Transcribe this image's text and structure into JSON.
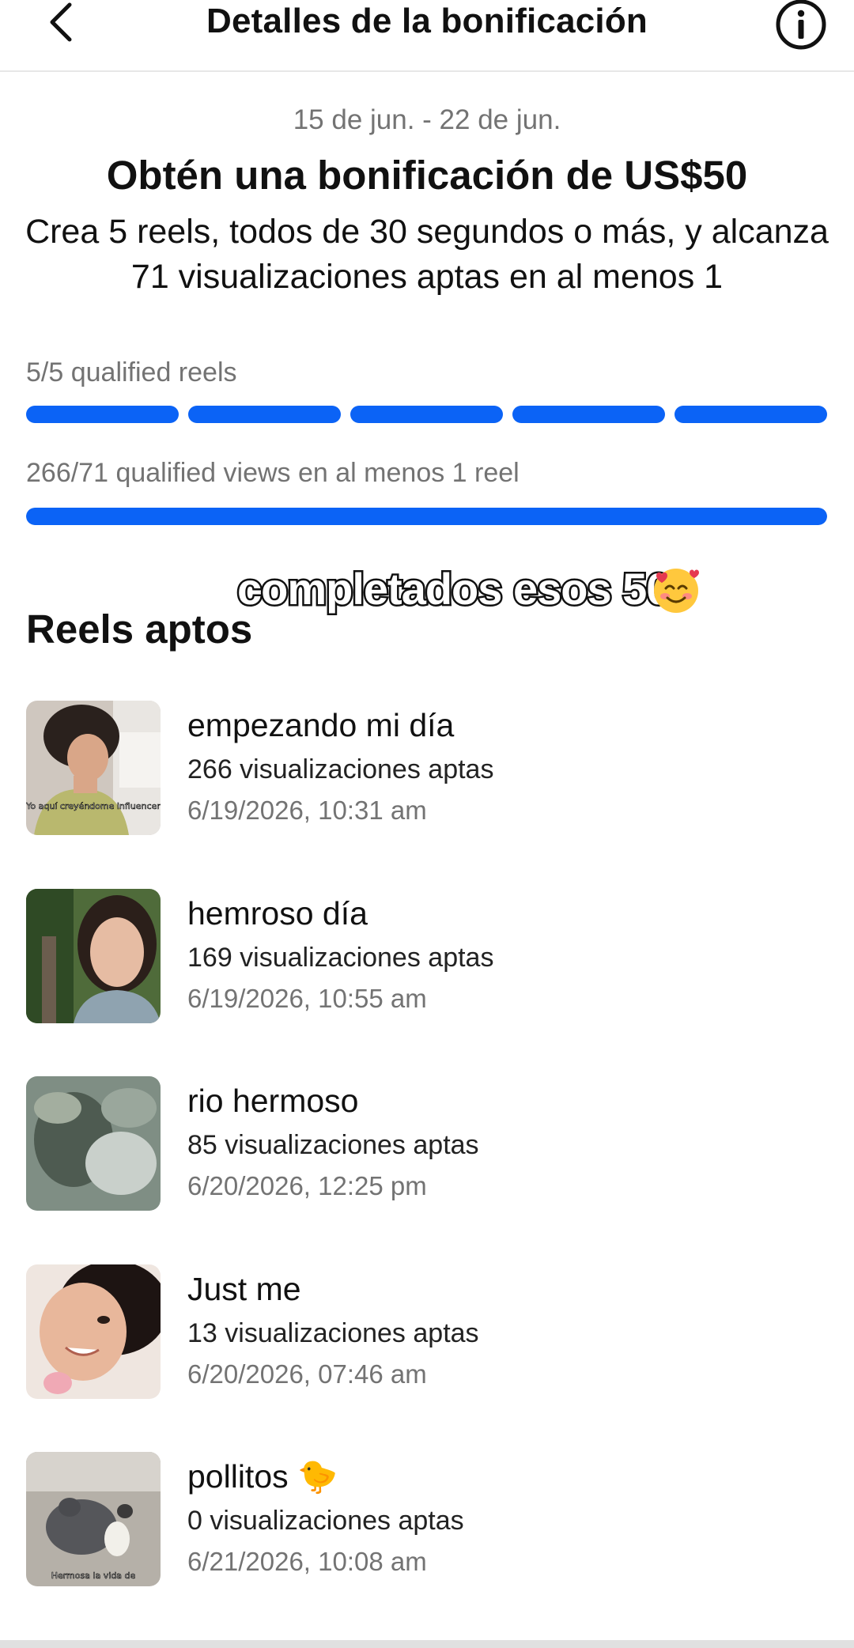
{
  "header": {
    "title": "Detalles de la bonificación",
    "back_icon": "chevron-left-icon",
    "info_icon": "info-circle-icon"
  },
  "bonus": {
    "date_range": "15 de jun. - 22 de jun.",
    "title": "Obtén una bonificación de US$50",
    "description": "Crea 5 reels, todos de 30 segundos o más, y alcanza 71 visualizaciones aptas en al menos 1"
  },
  "progress": {
    "reels_label": "5/5 qualified reels",
    "reels_done": 5,
    "reels_total": 5,
    "views_label": "266/71 qualified views en al menos 1 reel",
    "views_fill_fraction": 1.0
  },
  "overlay": {
    "caption": "completados esos 50",
    "emoji_icon": "smiling-face-with-hearts-icon"
  },
  "section": {
    "title": "Reels aptos"
  },
  "reels": [
    {
      "title": "empezando mi día",
      "views": "266 visualizaciones aptas",
      "date": "6/19/2026, 10:31 am",
      "thumb_caption": "Yo aquí creyéndome influencer"
    },
    {
      "title": "hemroso día",
      "views": "169 visualizaciones aptas",
      "date": "6/19/2026, 10:55 am",
      "thumb_caption": ""
    },
    {
      "title": "rio hermoso",
      "views": "85 visualizaciones aptas",
      "date": "6/20/2026, 12:25 pm",
      "thumb_caption": ""
    },
    {
      "title": "Just me",
      "views": "13 visualizaciones aptas",
      "date": "6/20/2026, 07:46 am",
      "thumb_caption": ""
    },
    {
      "title": "pollitos 🐤",
      "views": "0 visualizaciones aptas",
      "date": "6/21/2026, 10:08 am",
      "thumb_caption": "Hermosa la vida de"
    }
  ],
  "colors": {
    "accent": "#0b63f6",
    "muted_text": "#737373",
    "track": "#dbdbdb"
  }
}
